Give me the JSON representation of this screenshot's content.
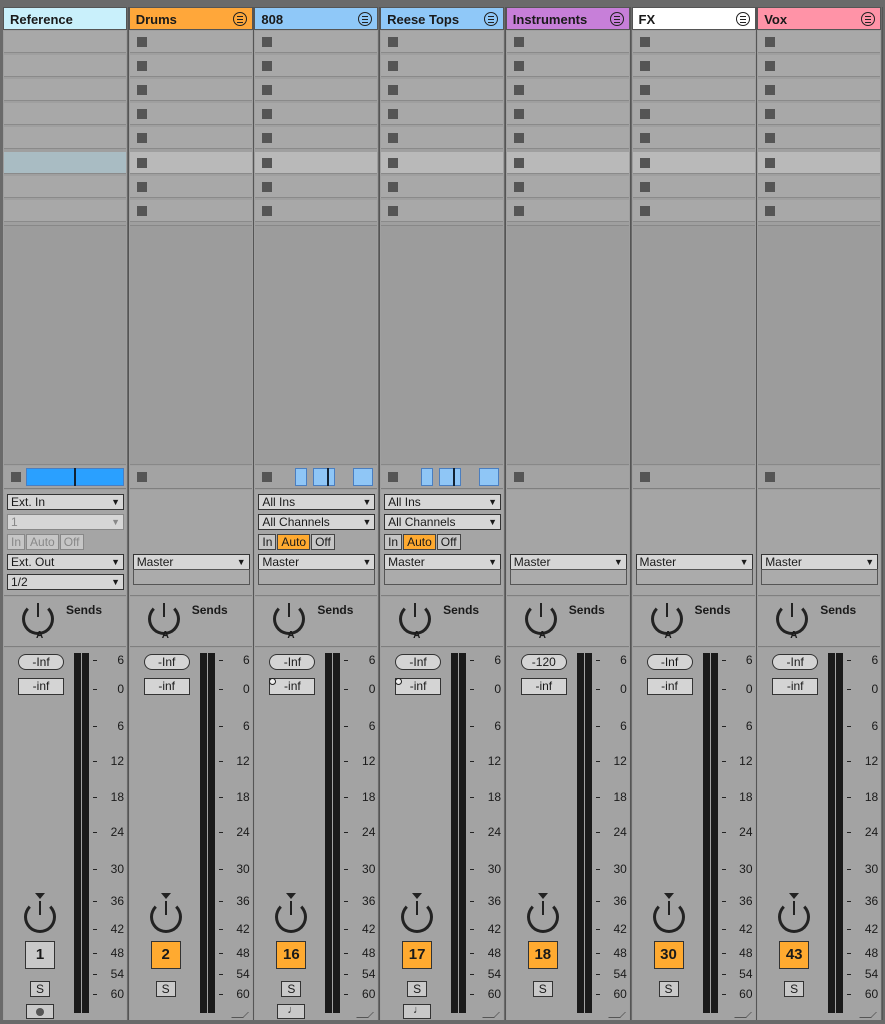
{
  "tracks": [
    {
      "name": "Reference",
      "color": "#c9f0fb",
      "input_type": "Ext. In",
      "input_channel": "1",
      "monitor": [
        "In",
        "Auto",
        "Off"
      ],
      "monitor_active": "",
      "output": "Ext. Out",
      "output_channel": "1/2",
      "send_label": "Sends",
      "peak": "-Inf",
      "volume": "-inf",
      "number": "1",
      "solo": "S",
      "number_active": false
    },
    {
      "name": "Drums",
      "color": "#ffa73a",
      "output": "Master",
      "send_label": "Sends",
      "peak": "-Inf",
      "volume": "-inf",
      "number": "2",
      "solo": "S",
      "number_active": true
    },
    {
      "name": "808",
      "color": "#8fc8f8",
      "input_type": "All Ins",
      "input_channel": "All Channels",
      "monitor": [
        "In",
        "Auto",
        "Off"
      ],
      "monitor_active": "Auto",
      "output": "Master",
      "send_label": "Sends",
      "peak": "-Inf",
      "volume": "-inf",
      "number": "16",
      "solo": "S",
      "number_active": true
    },
    {
      "name": "Reese Tops",
      "color": "#8fc8f8",
      "input_type": "All Ins",
      "input_channel": "All Channels",
      "monitor": [
        "In",
        "Auto",
        "Off"
      ],
      "monitor_active": "Auto",
      "output": "Master",
      "send_label": "Sends",
      "peak": "-Inf",
      "volume": "-inf",
      "number": "17",
      "solo": "S",
      "number_active": true
    },
    {
      "name": "Instruments",
      "color": "#c77fd9",
      "output": "Master",
      "send_label": "Sends",
      "peak": "-120",
      "volume": "-inf",
      "number": "18",
      "solo": "S",
      "number_active": true
    },
    {
      "name": "FX",
      "color": "#ffffff",
      "output": "Master",
      "send_label": "Sends",
      "peak": "-Inf",
      "volume": "-inf",
      "number": "30",
      "solo": "S",
      "number_active": true
    },
    {
      "name": "Vox",
      "color": "#ff93a7",
      "output": "Master",
      "send_label": "Sends",
      "peak": "-Inf",
      "volume": "-inf",
      "number": "43",
      "solo": "S",
      "number_active": true
    }
  ],
  "knob_label": "A",
  "meter_scale": [
    "6",
    "0",
    "6",
    "12",
    "18",
    "24",
    "30",
    "36",
    "42",
    "48",
    "54",
    "60"
  ]
}
